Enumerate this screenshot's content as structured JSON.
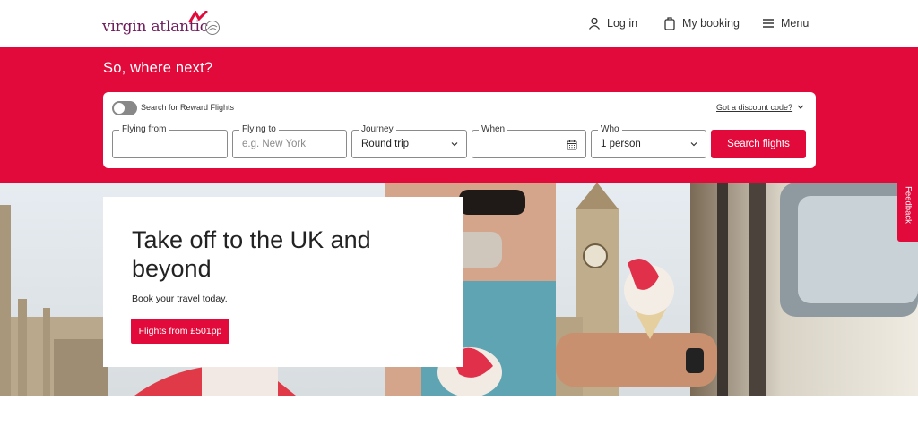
{
  "header": {
    "logo_text": "virgin atlantic",
    "nav": {
      "login": "Log in",
      "booking": "My booking",
      "menu": "Menu"
    }
  },
  "search": {
    "headline": "So, where next?",
    "reward_toggle_label": "Search for Reward Flights",
    "reward_toggle_on": false,
    "discount_link": "Got a discount code?",
    "fields": {
      "from_label": "Flying from",
      "from_value": "",
      "to_label": "Flying to",
      "to_placeholder": "e.g. New York",
      "journey_label": "Journey",
      "journey_value": "Round trip",
      "when_label": "When",
      "when_value": "",
      "who_label": "Who",
      "who_value": "1 person"
    },
    "submit_label": "Search flights"
  },
  "hero": {
    "title": "Take off to the UK and beyond",
    "subtitle": "Book your travel today.",
    "cta": "Flights from £501pp"
  },
  "feedback_label": "Feedback",
  "colors": {
    "brand_red": "#e10a3a",
    "logo_purple": "#6d1a5b"
  },
  "icons": [
    "user-icon",
    "bag-icon",
    "menu-icon",
    "chevron-down-icon",
    "calendar-icon"
  ]
}
